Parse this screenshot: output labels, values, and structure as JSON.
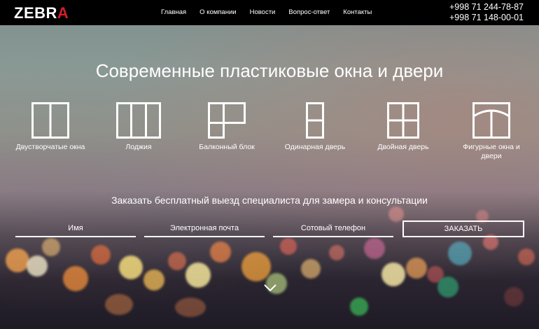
{
  "header": {
    "logo_main": "ZEBR",
    "logo_accent": "A",
    "nav": [
      "Главная",
      "О компании",
      "Новости",
      "Вопрос-ответ",
      "Контакты"
    ],
    "phones": [
      "+998 71 244-78-87",
      "+998 71 148-00-01"
    ]
  },
  "hero": {
    "title": "Современные пластиковые окна и двери",
    "types": [
      {
        "label": "Двустворчатые окна",
        "icon": "double-window-icon"
      },
      {
        "label": "Лоджия",
        "icon": "loggia-icon"
      },
      {
        "label": "Балконный блок",
        "icon": "balcony-block-icon"
      },
      {
        "label": "Одинарная дверь",
        "icon": "single-door-icon"
      },
      {
        "label": "Двойная дверь",
        "icon": "double-door-icon"
      },
      {
        "label": "Фигурные окна и двери",
        "icon": "arched-window-icon"
      }
    ],
    "order_text": "Заказать бесплатный выезд специалиста для замера и консультации",
    "form": {
      "name_placeholder": "Имя",
      "email_placeholder": "Электронная почта",
      "phone_placeholder": "Сотовый телефон",
      "submit_label": "ЗАКАЗАТЬ"
    }
  },
  "colors": {
    "topbar": "#000000",
    "logo_accent": "#d41f2b",
    "text": "#ffffff"
  }
}
